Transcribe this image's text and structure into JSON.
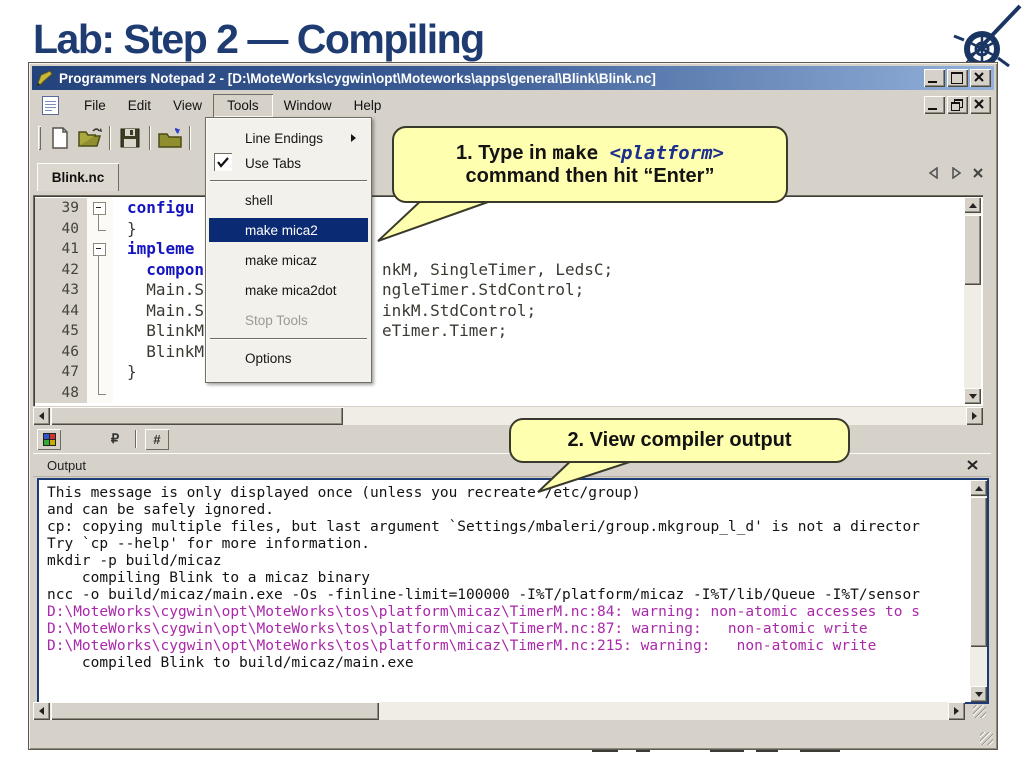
{
  "slide": {
    "title": "Lab: Step 2 — Compiling"
  },
  "colors": {
    "title_navy": "#1e3c72",
    "titlebar_gradient_left": "#24437c",
    "titlebar_gradient_right": "#93b2da",
    "menu_highlight": "#0b2a74",
    "keyword_blue": "#1515c0",
    "warning_magenta": "#aa28aa",
    "callout_yellow": "#ffffb0",
    "chrome_gray": "#d6d2c9",
    "output_border_navy": "#1c3a75"
  },
  "window": {
    "title": "Programmers Notepad 2 - [D:\\MoteWorks\\cygwin\\opt\\Moteworks\\apps\\general\\Blink\\Blink.nc]",
    "menus": [
      {
        "label": "File"
      },
      {
        "label": "Edit"
      },
      {
        "label": "View"
      },
      {
        "label": "Tools",
        "pressed": true
      },
      {
        "label": "Window"
      },
      {
        "label": "Help"
      }
    ]
  },
  "tools_menu": {
    "items": [
      {
        "label": "Line Endings",
        "submenu": true
      },
      {
        "label": "Use Tabs",
        "checked": true
      },
      {
        "sep": true
      },
      {
        "label": "shell",
        "gap": true
      },
      {
        "label": "make mica2",
        "highlighted": true
      },
      {
        "label": "make micaz",
        "gap": true
      },
      {
        "label": "make mica2dot",
        "gap": true
      },
      {
        "label": "Stop Tools",
        "disabled": true,
        "gap": true
      },
      {
        "sep": true
      },
      {
        "label": "Options",
        "gap": true
      }
    ]
  },
  "editor": {
    "tab_label": "Blink.nc",
    "lines": [
      {
        "num": "39",
        "fold": "box",
        "parts": [
          {
            "t": "configu",
            "kw": true
          }
        ],
        "right": ""
      },
      {
        "num": "40",
        "fold": "end",
        "parts": [
          {
            "t": "}"
          }
        ],
        "right": ""
      },
      {
        "num": "41",
        "fold": "box",
        "parts": [
          {
            "t": "impleme",
            "kw": true
          }
        ],
        "right": ""
      },
      {
        "num": "42",
        "fold": "line",
        "parts": [
          {
            "t": "  "
          },
          {
            "t": "compon",
            "kw": true
          }
        ],
        "right": "nkM, SingleTimer, LedsC;"
      },
      {
        "num": "43",
        "fold": "line",
        "parts": [
          {
            "t": "  Main.S"
          }
        ],
        "right": "ngleTimer.StdControl;"
      },
      {
        "num": "44",
        "fold": "line",
        "parts": [
          {
            "t": "  Main.S"
          }
        ],
        "right": "inkM.StdControl;"
      },
      {
        "num": "45",
        "fold": "line",
        "parts": [
          {
            "t": "  BlinkM"
          }
        ],
        "right": "eTimer.Timer;"
      },
      {
        "num": "46",
        "fold": "line",
        "parts": [
          {
            "t": "  BlinkM"
          }
        ],
        "right": ""
      },
      {
        "num": "47",
        "fold": "line",
        "parts": [
          {
            "t": "}"
          }
        ],
        "right": ""
      },
      {
        "num": "48",
        "fold": "end",
        "parts": [],
        "right": ""
      }
    ]
  },
  "minibar": {
    "wrap_glyph": "₽",
    "hash_glyph": "#"
  },
  "callout1": {
    "prefix": "1. Type in ",
    "code": "make ",
    "platform": "<platform>",
    "line2": "command then hit “Enter”"
  },
  "callout2": {
    "text": "2. View compiler output"
  },
  "output": {
    "title": "Output",
    "lines": [
      {
        "t": "This message is only displayed once (unless you recreate /etc/group)"
      },
      {
        "t": "and can be safely ignored."
      },
      {
        "t": "cp: copying multiple files, but last argument `Settings/mbaleri/group.mkgroup_l_d' is not a director"
      },
      {
        "t": "Try `cp --help' for more information."
      },
      {
        "t": "mkdir -p build/micaz"
      },
      {
        "t": "    compiling Blink to a micaz binary"
      },
      {
        "t": "ncc -o build/micaz/main.exe -Os -finline-limit=100000 -I%T/platform/micaz -I%T/lib/Queue -I%T/sensor"
      },
      {
        "t": "D:\\MoteWorks\\cygwin\\opt\\MoteWorks\\tos\\platform\\micaz\\TimerM.nc:84: warning: non-atomic accesses to s",
        "warn": true
      },
      {
        "t": "D:\\MoteWorks\\cygwin\\opt\\MoteWorks\\tos\\platform\\micaz\\TimerM.nc:87: warning:   non-atomic write",
        "warn": true
      },
      {
        "t": "D:\\MoteWorks\\cygwin\\opt\\MoteWorks\\tos\\platform\\micaz\\TimerM.nc:215: warning:   non-atomic write",
        "warn": true
      },
      {
        "t": "    compiled Blink to build/micaz/main.exe"
      }
    ]
  }
}
